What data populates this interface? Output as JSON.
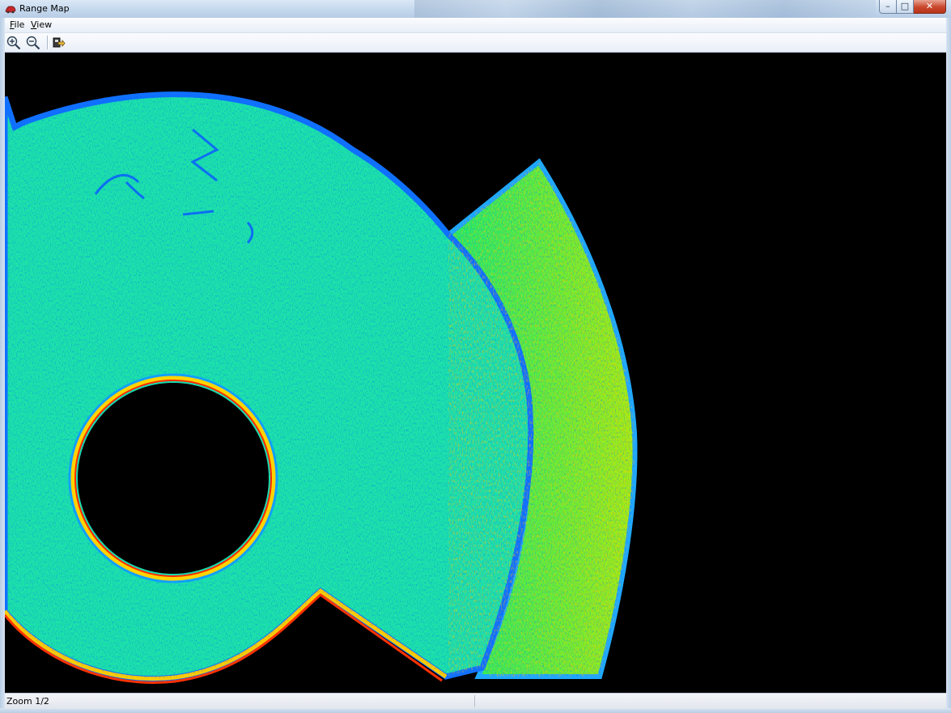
{
  "window": {
    "title": "Range Map",
    "caption_buttons": {
      "minimize": "–",
      "maximize": "□",
      "close": "✕"
    }
  },
  "menu": {
    "items": [
      {
        "label": "File",
        "mnemonic": "F",
        "rest": "ile"
      },
      {
        "label": "View",
        "mnemonic": "V",
        "rest": "iew"
      }
    ]
  },
  "toolbar": {
    "tools": [
      {
        "name": "zoom-in",
        "icon": "magnifier-plus-icon"
      },
      {
        "name": "zoom-out",
        "icon": "magnifier-minus-icon"
      },
      {
        "name": "export",
        "icon": "export-icon"
      }
    ]
  },
  "canvas": {
    "colormap": [
      "#0010ff",
      "#00b7ff",
      "#00f0c0",
      "#1cf05a",
      "#c8f000",
      "#ffb000",
      "#ff2000"
    ],
    "background": "#000000"
  },
  "status": {
    "zoom_text": "Zoom 1/2",
    "pane2": ""
  }
}
